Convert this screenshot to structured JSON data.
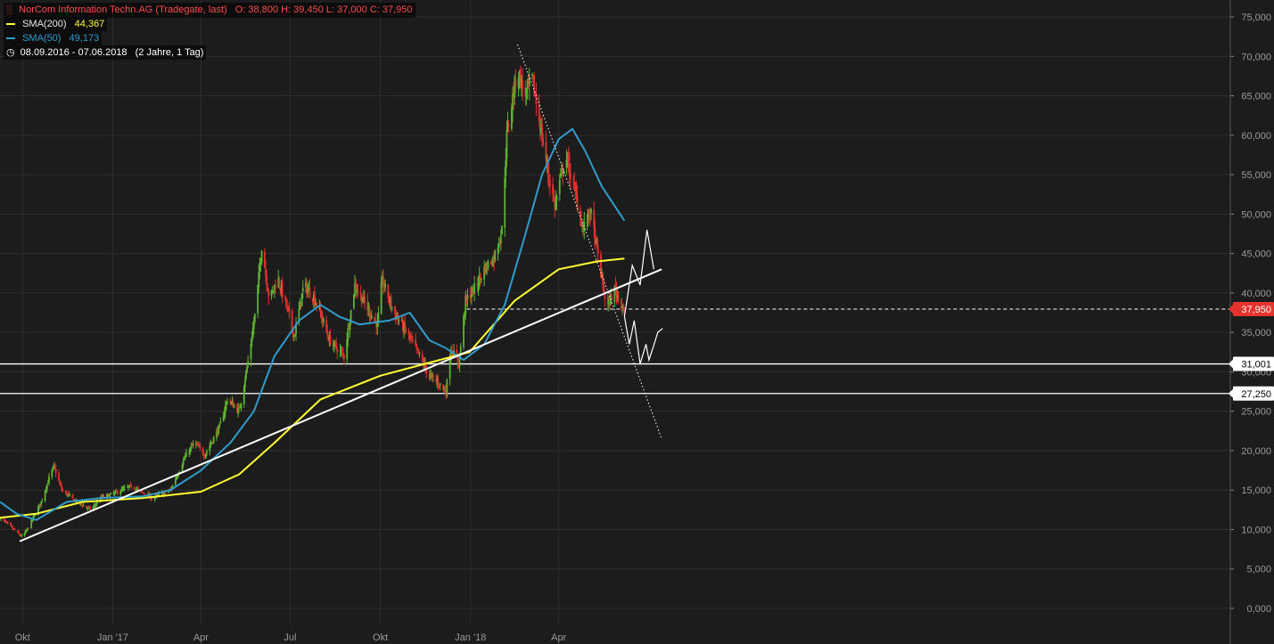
{
  "header": {
    "title": "NorCom Information Techn.AG (Tradegate, last)",
    "ohlc": "O: 38,800  H: 39,450  L: 37,000  C: 37,950",
    "sma200_label": "SMA(200)",
    "sma200_value": "44,367",
    "sma50_label": "SMA(50)",
    "sma50_value": "49,173",
    "period": "08.09.2016 - 07.06.2018",
    "period_detail": "(2 Jahre, 1 Tag)"
  },
  "colors": {
    "background": "#1c1c1c",
    "grid": "#2e2e2e",
    "up": "#5cb531",
    "down": "#e0312f",
    "sma200": "#ffff33",
    "sma50": "#2f9ccc",
    "annotation": "#ffffff",
    "last_price_badge": "#e8322e"
  },
  "chart_data": {
    "type": "candlestick",
    "y_axis": {
      "min": 0,
      "max": 75000,
      "step": 5000,
      "position": "right",
      "tick_labels": [
        "0,000",
        "5,000",
        "10,000",
        "15,000",
        "20,000",
        "25,000",
        "30,000",
        "35,000",
        "40,000",
        "45,000",
        "50,000",
        "55,000",
        "60,000",
        "65,000",
        "70,000",
        "75,000"
      ]
    },
    "x_axis": {
      "start": "2016-09-08",
      "end": "2018-07-15",
      "ticks": [
        {
          "date": "2016-10-01",
          "label": "Okt"
        },
        {
          "date": "2017-01-01",
          "label": "Jan '17"
        },
        {
          "date": "2017-04-01",
          "label": "Apr"
        },
        {
          "date": "2017-07-01",
          "label": "Jul"
        },
        {
          "date": "2017-10-01",
          "label": "Okt"
        },
        {
          "date": "2018-01-01",
          "label": "Jan '18"
        },
        {
          "date": "2018-04-01",
          "label": "Apr"
        }
      ]
    },
    "grid": true,
    "last_price": {
      "value": 37950,
      "label": "37,950",
      "from": "2017-12-28"
    },
    "horizontal_levels": [
      {
        "value": 31001,
        "label": "31,001"
      },
      {
        "value": 27250,
        "label": "27,250"
      }
    ],
    "price_path": [
      [
        "2016-09-08",
        11500
      ],
      [
        "2016-09-22",
        10000
      ],
      [
        "2016-10-01",
        9000
      ],
      [
        "2016-10-10",
        11000
      ],
      [
        "2016-10-20",
        13500
      ],
      [
        "2016-10-28",
        16500
      ],
      [
        "2016-11-02",
        18000
      ],
      [
        "2016-11-10",
        15000
      ],
      [
        "2016-11-25",
        13500
      ],
      [
        "2016-12-10",
        12500
      ],
      [
        "2016-12-20",
        14000
      ],
      [
        "2017-01-01",
        14500
      ],
      [
        "2017-01-20",
        15500
      ],
      [
        "2017-02-10",
        14000
      ],
      [
        "2017-03-01",
        15000
      ],
      [
        "2017-03-15",
        19000
      ],
      [
        "2017-03-25",
        21000
      ],
      [
        "2017-04-05",
        19500
      ],
      [
        "2017-04-20",
        23000
      ],
      [
        "2017-04-28",
        26500
      ],
      [
        "2017-05-10",
        25000
      ],
      [
        "2017-05-20",
        32000
      ],
      [
        "2017-05-27",
        38000
      ],
      [
        "2017-06-02",
        46000
      ],
      [
        "2017-06-10",
        39000
      ],
      [
        "2017-06-18",
        42000
      ],
      [
        "2017-06-28",
        38000
      ],
      [
        "2017-07-05",
        34500
      ],
      [
        "2017-07-15",
        41000
      ],
      [
        "2017-07-25",
        39500
      ],
      [
        "2017-08-02",
        37000
      ],
      [
        "2017-08-10",
        34000
      ],
      [
        "2017-08-25",
        32000
      ],
      [
        "2017-09-05",
        41000
      ],
      [
        "2017-09-18",
        38000
      ],
      [
        "2017-09-28",
        36000
      ],
      [
        "2017-10-03",
        41500
      ],
      [
        "2017-10-15",
        37500
      ],
      [
        "2017-10-28",
        35000
      ],
      [
        "2017-11-10",
        32000
      ],
      [
        "2017-11-20",
        29500
      ],
      [
        "2017-11-30",
        28500
      ],
      [
        "2017-12-07",
        27500
      ],
      [
        "2017-12-12",
        33000
      ],
      [
        "2017-12-20",
        31000
      ],
      [
        "2017-12-27",
        39000
      ],
      [
        "2018-01-05",
        40500
      ],
      [
        "2018-01-15",
        43000
      ],
      [
        "2018-01-25",
        44500
      ],
      [
        "2018-02-02",
        48000
      ],
      [
        "2018-02-07",
        60000
      ],
      [
        "2018-02-12",
        64000
      ],
      [
        "2018-02-18",
        68500
      ],
      [
        "2018-02-25",
        65000
      ],
      [
        "2018-03-05",
        67000
      ],
      [
        "2018-03-12",
        62000
      ],
      [
        "2018-03-20",
        56000
      ],
      [
        "2018-03-28",
        51000
      ],
      [
        "2018-04-08",
        57500
      ],
      [
        "2018-04-18",
        52500
      ],
      [
        "2018-04-26",
        48000
      ],
      [
        "2018-05-03",
        50500
      ],
      [
        "2018-05-12",
        44000
      ],
      [
        "2018-05-20",
        38000
      ],
      [
        "2018-05-28",
        40500
      ],
      [
        "2018-06-07",
        37950
      ]
    ],
    "series": [
      {
        "name": "SMA(200)",
        "value_label": "44,367",
        "points": [
          [
            "2016-09-08",
            11500
          ],
          [
            "2016-10-15",
            12000
          ],
          [
            "2016-12-01",
            13500
          ],
          [
            "2017-02-01",
            14000
          ],
          [
            "2017-04-01",
            14800
          ],
          [
            "2017-05-10",
            17000
          ],
          [
            "2017-06-15",
            21000
          ],
          [
            "2017-08-01",
            26500
          ],
          [
            "2017-10-01",
            29500
          ],
          [
            "2017-11-15",
            31000
          ],
          [
            "2017-12-31",
            32500
          ],
          [
            "2018-02-15",
            39000
          ],
          [
            "2018-04-01",
            43000
          ],
          [
            "2018-05-10",
            44000
          ],
          [
            "2018-06-07",
            44367
          ]
        ]
      },
      {
        "name": "SMA(50)",
        "value_label": "49,173",
        "points": [
          [
            "2016-09-08",
            13500
          ],
          [
            "2016-09-25",
            12000
          ],
          [
            "2016-10-15",
            11200
          ],
          [
            "2016-11-15",
            13500
          ],
          [
            "2016-12-20",
            14000
          ],
          [
            "2017-02-01",
            14200
          ],
          [
            "2017-03-01",
            15000
          ],
          [
            "2017-04-01",
            17500
          ],
          [
            "2017-05-01",
            21000
          ],
          [
            "2017-05-25",
            25000
          ],
          [
            "2017-06-15",
            32000
          ],
          [
            "2017-07-10",
            36500
          ],
          [
            "2017-08-01",
            38500
          ],
          [
            "2017-08-20",
            37000
          ],
          [
            "2017-09-10",
            36000
          ],
          [
            "2017-10-10",
            36500
          ],
          [
            "2017-10-31",
            37500
          ],
          [
            "2017-11-20",
            34000
          ],
          [
            "2017-12-07",
            33000
          ],
          [
            "2017-12-25",
            31500
          ],
          [
            "2018-01-15",
            33500
          ],
          [
            "2018-02-05",
            38500
          ],
          [
            "2018-02-25",
            47000
          ],
          [
            "2018-03-15",
            55000
          ],
          [
            "2018-04-01",
            59500
          ],
          [
            "2018-04-15",
            60800
          ],
          [
            "2018-04-28",
            58000
          ],
          [
            "2018-05-15",
            53500
          ],
          [
            "2018-06-07",
            49173
          ]
        ]
      }
    ],
    "trendlines": [
      {
        "style": "solid",
        "from": [
          "2016-09-28",
          8500
        ],
        "to": [
          "2018-07-15",
          43000
        ]
      },
      {
        "style": "dotted",
        "from": [
          "2018-02-18",
          71500
        ],
        "to": [
          "2018-07-15",
          21500
        ]
      }
    ],
    "projection": [
      [
        "2018-06-07",
        37000
      ],
      [
        "2018-06-12",
        33500
      ],
      [
        "2018-06-17",
        36500
      ],
      [
        "2018-06-23",
        31000
      ],
      [
        "2018-06-29",
        33500
      ],
      [
        "2018-07-02",
        31500
      ],
      [
        "2018-07-06",
        33000
      ],
      [
        "2018-07-11",
        35000
      ],
      [
        "2018-07-16",
        35500
      ]
    ],
    "projection_alt": [
      [
        "2018-06-07",
        37000
      ],
      [
        "2018-06-15",
        43500
      ],
      [
        "2018-06-23",
        41000
      ],
      [
        "2018-06-30",
        48000
      ],
      [
        "2018-07-07",
        43000
      ]
    ]
  }
}
